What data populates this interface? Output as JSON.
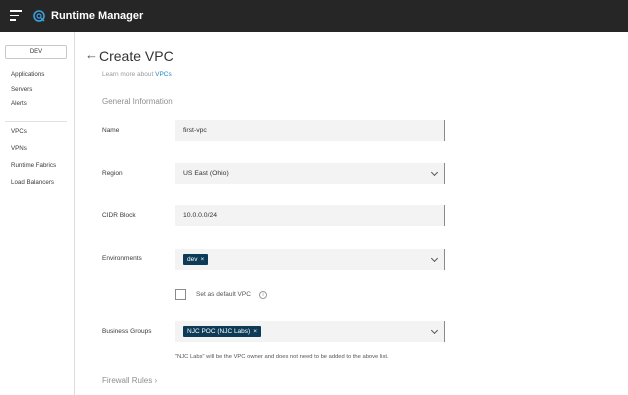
{
  "app": {
    "title": "Runtime Manager"
  },
  "sidebar": {
    "environment": "DEV",
    "groups": [
      {
        "items": [
          "Applications",
          "Servers",
          "Alerts"
        ]
      },
      {
        "items": [
          "VPCs",
          "VPNs",
          "Runtime Fabrics",
          "Load Balancers"
        ]
      }
    ]
  },
  "page": {
    "back_icon": "arrow-left-icon",
    "title": "Create VPC",
    "learn_more_prefix": "Learn more about ",
    "learn_more_link": "VPCs",
    "section_general": "General Information",
    "section_firewall": "Firewall Rules",
    "firewall_chevron": "›"
  },
  "form": {
    "name": {
      "label": "Name",
      "value": "first-vpc"
    },
    "region": {
      "label": "Region",
      "value": "US East (Ohio)"
    },
    "cidr": {
      "label": "CIDR Block",
      "value": "10.0.0.0/24"
    },
    "environments": {
      "label": "Environments",
      "tags": [
        "dev"
      ]
    },
    "default_vpc": {
      "label": "Set as default VPC",
      "checked": false
    },
    "business_groups": {
      "label": "Business Groups",
      "tags": [
        "NJC POC (NJC Labs)"
      ],
      "hint": "\"NJC Labs\" will be the VPC owner and does not need to be added to the above list."
    },
    "tag_remove": "×",
    "info_glyph": "i"
  },
  "colors": {
    "topbar": "#262626",
    "link": "#1f89c7",
    "tag": "#0d3b57"
  }
}
